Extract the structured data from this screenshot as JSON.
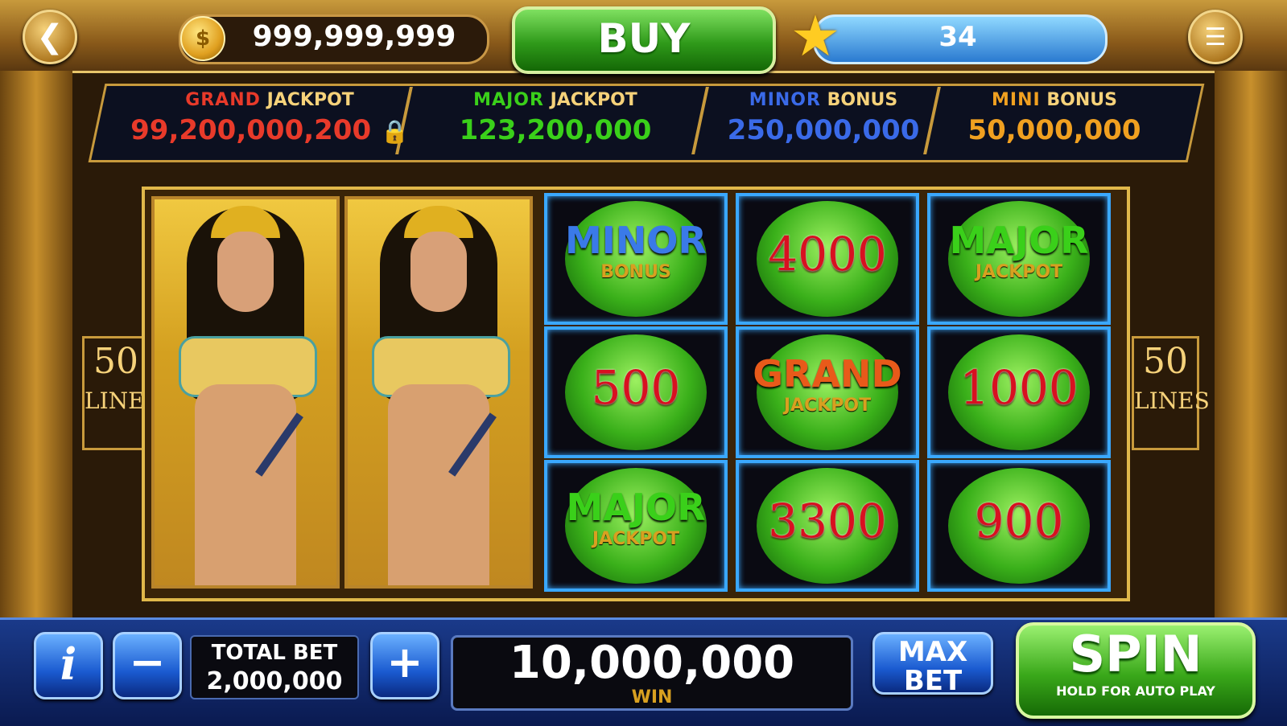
{
  "top_bar": {
    "back_icon": "chevron-left-icon",
    "coins": "999,999,999",
    "coin_icon": "coin-icon",
    "buy_label": "BUY",
    "level": "34",
    "star_icon": "star-icon",
    "menu_icon": "hamburger-menu-icon"
  },
  "jackpots": [
    {
      "tag": "GRAND",
      "kind": "JACKPOT",
      "value": "99,200,000,200",
      "color": "#e83a2a",
      "locked": true
    },
    {
      "tag": "MAJOR",
      "kind": "JACKPOT",
      "value": "123,200,000",
      "color": "#3ad01a"
    },
    {
      "tag": "MINOR",
      "kind": "BONUS",
      "value": "250,000,000",
      "color": "#3a6ae8"
    },
    {
      "tag": "MINI",
      "kind": "BONUS",
      "value": "50,000,000",
      "color": "#f0a020"
    }
  ],
  "lines": {
    "count": "50",
    "label": "LINES"
  },
  "reels": {
    "grid": [
      [
        {
          "word": "MINOR",
          "sub": "BONUS",
          "color": "#3a7ae8"
        },
        {
          "value": "4000"
        },
        {
          "word": "MAJOR",
          "sub": "JACKPOT",
          "color": "#3ad01a"
        }
      ],
      [
        {
          "value": "500"
        },
        {
          "word": "GRAND",
          "sub": "JACKPOT",
          "color": "#e85a1a"
        },
        {
          "value": "1000"
        }
      ],
      [
        {
          "word": "MAJOR",
          "sub": "JACKPOT",
          "color": "#3ad01a"
        },
        {
          "value": "3300"
        },
        {
          "value": "900"
        }
      ]
    ]
  },
  "bottom_bar": {
    "info_label": "i",
    "minus_label": "−",
    "plus_label": "+",
    "total_bet_label": "TOTAL BET",
    "total_bet_value": "2,000,000",
    "win_value": "10,000,000",
    "win_label": "WIN",
    "max_bet_line1": "MAX",
    "max_bet_line2": "BET",
    "spin_label": "SPIN",
    "spin_sub": "HOLD FOR AUTO PLAY"
  }
}
